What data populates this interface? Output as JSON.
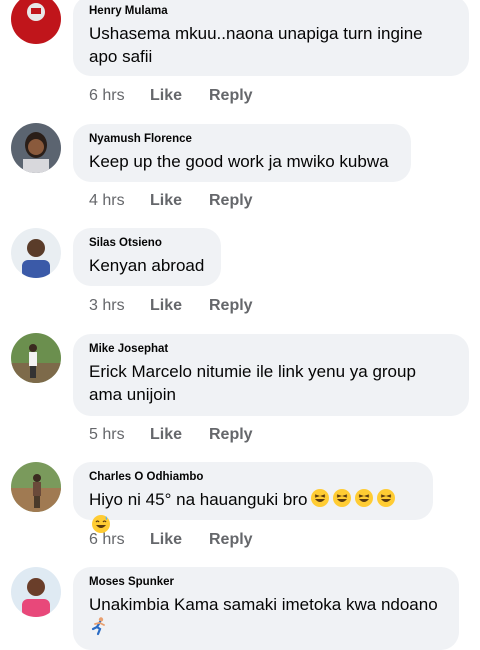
{
  "comments": [
    {
      "author": "Henry Mulama",
      "text": "Ushasema mkuu..naona unapiga turn ingine apo safii",
      "time": "6 hrs",
      "like": "Like",
      "reply": "Reply"
    },
    {
      "author": "Nyamush Florence",
      "text": "Keep up the good work ja mwiko kubwa",
      "time": "4 hrs",
      "like": "Like",
      "reply": "Reply"
    },
    {
      "author": "Silas Otsieno",
      "text": "Kenyan abroad",
      "time": "3 hrs",
      "like": "Like",
      "reply": "Reply"
    },
    {
      "author": "Mike Josephat",
      "text": "Erick Marcelo nitumie ile link yenu ya group ama unijoin",
      "time": "5 hrs",
      "like": "Like",
      "reply": "Reply"
    },
    {
      "author": "Charles O Odhiambo",
      "text": "Hiyo ni 45° na hauanguki bro",
      "time": "6 hrs",
      "like": "Like",
      "reply": "Reply",
      "emoji": [
        "grinning-squinting",
        "grinning-squinting",
        "grinning-squinting",
        "grinning-squinting",
        "grinning-sweat"
      ]
    },
    {
      "author": "Moses Spunker",
      "text": "Unakimbia Kama samaki imetoka kwa ndoano",
      "time": "",
      "like": "",
      "reply": "",
      "emoji": [
        "person-running"
      ]
    }
  ],
  "colors": {
    "bubble": "#f0f2f5",
    "meta": "#65676b",
    "text": "#050505"
  }
}
